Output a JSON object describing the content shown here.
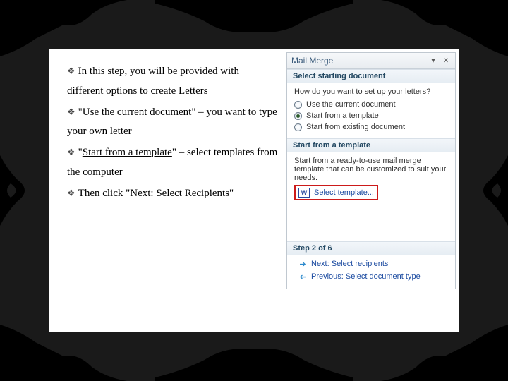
{
  "left": {
    "b1_pre": "In this step, you will be provided with different options to create Letters",
    "b2_q1": "\"",
    "b2_u": "Use the current document",
    "b2_post": "\" – you want to type your own letter",
    "b3_q1": "\"",
    "b3_u": "Start from a template",
    "b3_post": "\" – select templates from the computer",
    "b4": "Then click \"Next: Select Recipients\""
  },
  "pane": {
    "title": "Mail Merge",
    "sec1_heading": "Select starting document",
    "sec1_question": "How do you want to set up your letters?",
    "radio1": "Use the current document",
    "radio2": "Start from a template",
    "radio3": "Start from existing document",
    "sec2_heading": "Start from a template",
    "sec2_desc": "Start from a ready-to-use mail merge template that can be customized to suit your needs.",
    "select_template": "Select template...",
    "step_label": "Step 2 of 6",
    "next_label": "Next: Select recipients",
    "prev_label": "Previous: Select document type"
  }
}
